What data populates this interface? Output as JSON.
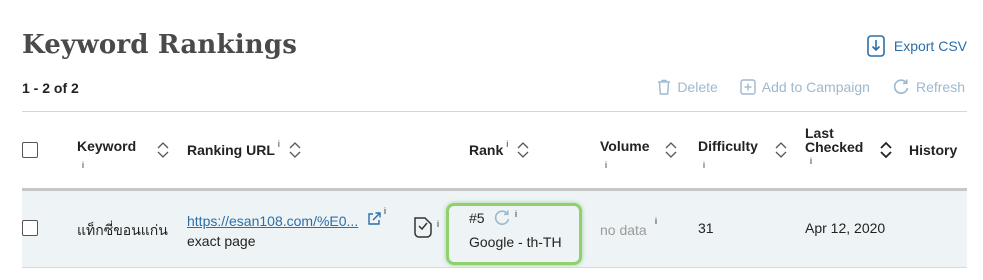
{
  "page": {
    "title": "Keyword Rankings",
    "export_label": "Export CSV",
    "count_text": "1 - 2 of 2"
  },
  "actions": {
    "delete": "Delete",
    "add_to_campaign": "Add to Campaign",
    "refresh": "Refresh"
  },
  "columns": {
    "keyword": "Keyword",
    "ranking_url": "Ranking URL",
    "rank": "Rank",
    "volume": "Volume",
    "difficulty": "Difficulty",
    "last_checked_1": "Last",
    "last_checked_2": "Checked",
    "history": "History",
    "info": "i"
  },
  "rows": [
    {
      "keyword": "แท็กซี่ขอนแก่น",
      "url": "https://esan108.com/%E0...",
      "match": "exact page",
      "rank": "#5",
      "engine": "Google - th-TH",
      "volume": "no data",
      "difficulty": "31",
      "last_checked": "Apr 12, 2020"
    }
  ],
  "colors": {
    "link": "#2c6ea8",
    "action_muted": "#9db9cf",
    "rank_highlight": "#8fd16e",
    "row_bg": "#eef4f5"
  }
}
